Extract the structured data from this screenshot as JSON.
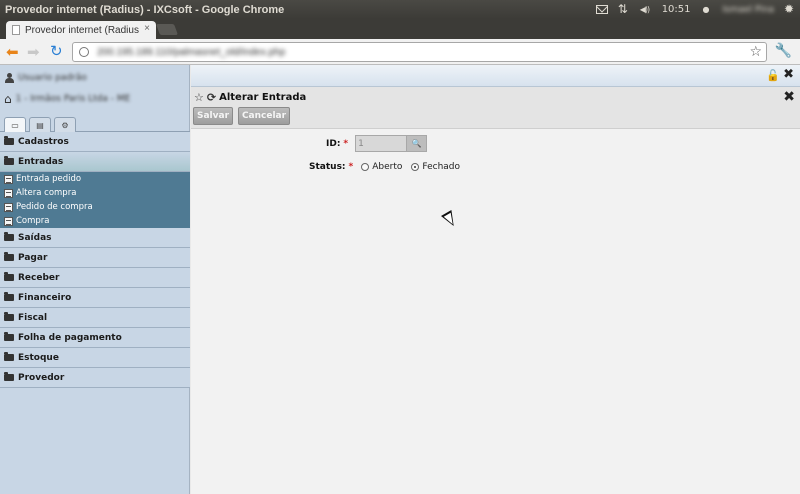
{
  "window": {
    "title": "Provedor internet (Radius) - IXCsoft - Google Chrome"
  },
  "tray": {
    "time": "10:51",
    "user": "Ismael Pina"
  },
  "browser": {
    "tab_title": "Provedor internet (Radius",
    "tab_close": "×",
    "url": "200.195.189.110/palmasnet_old/index.php"
  },
  "sidebar": {
    "user": "Usuario padrão",
    "company": "1 - Irmãos Paris Ltda - ME",
    "menu": {
      "cadastros": "Cadastros",
      "entradas": "Entradas",
      "entrada_pedido": "Entrada pedido",
      "altera_compra": "Altera compra",
      "pedido_compra": "Pedido de compra",
      "compra": "Compra",
      "saidas": "Saídas",
      "pagar": "Pagar",
      "receber": "Receber",
      "financeiro": "Financeiro",
      "fiscal": "Fiscal",
      "folha": "Folha de pagamento",
      "estoque": "Estoque",
      "provedor": "Provedor"
    }
  },
  "panel": {
    "title": "Alterar Entrada",
    "save": "Salvar",
    "cancel": "Cancelar",
    "id_label": "ID:",
    "required": "*",
    "id_value": "1",
    "status_label": "Status:",
    "status_open": "Aberto",
    "status_closed": "Fechado",
    "status_selected": "Fechado"
  }
}
